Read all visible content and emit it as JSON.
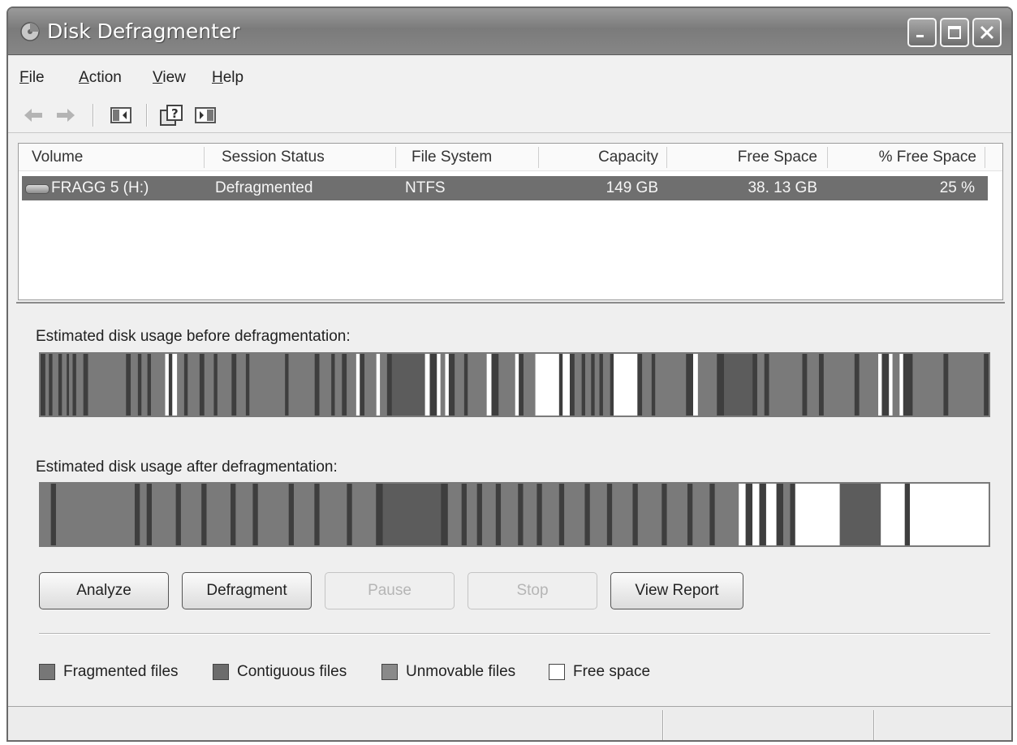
{
  "window": {
    "title": "Disk Defragmenter"
  },
  "menu": {
    "items": [
      {
        "key": "F",
        "rest": "ile"
      },
      {
        "key": "A",
        "rest": "ction"
      },
      {
        "key": "V",
        "rest": "iew"
      },
      {
        "key": "H",
        "rest": "elp"
      }
    ]
  },
  "toolbar": {
    "icons": [
      "back-arrow-icon",
      "forward-arrow-icon",
      "show-hide-console-tree-icon",
      "help-icon",
      "show-hide-action-pane-icon"
    ]
  },
  "volumes": {
    "columns": [
      "Volume",
      "Session Status",
      "File System",
      "Capacity",
      "Free Space",
      "% Free Space"
    ],
    "rows": [
      {
        "volume": "FRAGG 5 (H:)",
        "session_status": "Defragmented",
        "file_system": "NTFS",
        "capacity": "149 GB",
        "free_space": "38. 13 GB",
        "percent_free": "25 %"
      }
    ]
  },
  "usage": {
    "before_label": "Estimated disk usage before defragmentation:",
    "after_label": "Estimated disk usage after defragmentation:"
  },
  "buttons": {
    "analyze": "Analyze",
    "defragment": "Defragment",
    "pause": "Pause",
    "stop": "Stop",
    "view_report": "View Report"
  },
  "legend": {
    "items": [
      {
        "label": "Fragmented files",
        "color": "#777777"
      },
      {
        "label": "Contiguous files",
        "color": "#6c6c6c"
      },
      {
        "label": "Unmovable files",
        "color": "#8a8a8a"
      },
      {
        "label": "Free space",
        "color": "#ffffff"
      }
    ]
  },
  "colors": {
    "fragmented": "#7a7a7a",
    "contiguous": "#5c5c5c",
    "dark_stripe": "#3e3e3e",
    "free": "#ffffff"
  }
}
